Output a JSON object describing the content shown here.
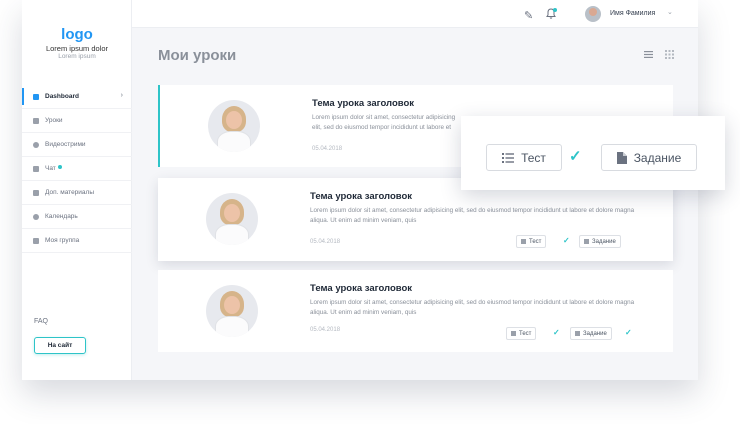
{
  "brand": {
    "logo": "logo",
    "title": "Lorem ipsum dolor",
    "subtitle": "Lorem ipsum"
  },
  "sidebar": {
    "items": [
      {
        "label": "Dashboard",
        "icon": "grid-icon"
      },
      {
        "label": "Уроки",
        "icon": "book-icon"
      },
      {
        "label": "Видеострими",
        "icon": "video-icon"
      },
      {
        "label": "Чат",
        "icon": "chat-icon"
      },
      {
        "label": "Доп. материалы",
        "icon": "folder-icon"
      },
      {
        "label": "Календарь",
        "icon": "calendar-icon"
      },
      {
        "label": "Моя группа",
        "icon": "group-icon"
      }
    ],
    "faq": "FAQ",
    "site_button": "На сайт"
  },
  "header": {
    "username": "Имя Фамилия"
  },
  "page": {
    "title": "Мои уроки"
  },
  "lessons": [
    {
      "title": "Тема урока заголовок",
      "text": "Lorem ipsum dolor sit amet, consectetur adipisicing elit, sed do eiusmod tempor incididunt ut labore et dolore magna aliqua. Ut enim ad minim veniam, quis",
      "date": "05.04.2018"
    },
    {
      "title": "Тема урока заголовок",
      "text": "Lorem ipsum dolor sit amet, consectetur adipisicing elit, sed do eiusmod tempor incididunt ut labore et dolore magna aliqua. Ut enim ad minim veniam, quis",
      "date": "05.04.2018",
      "test_label": "Тест",
      "task_label": "Задание"
    },
    {
      "title": "Тема урока заголовок",
      "text": "Lorem ipsum dolor sit amet, consectetur adipisicing elit, sed do eiusmod tempor incididunt ut labore et dolore magna aliqua. Ut enim ad minim veniam, quis",
      "date": "05.04.2018",
      "test_label": "Тест",
      "task_label": "Задание"
    }
  ],
  "popup": {
    "test_label": "Тест",
    "task_label": "Задание"
  },
  "colors": {
    "accent": "#2ec4c8",
    "brand": "#2196f3",
    "background": "#f5f6f9"
  }
}
